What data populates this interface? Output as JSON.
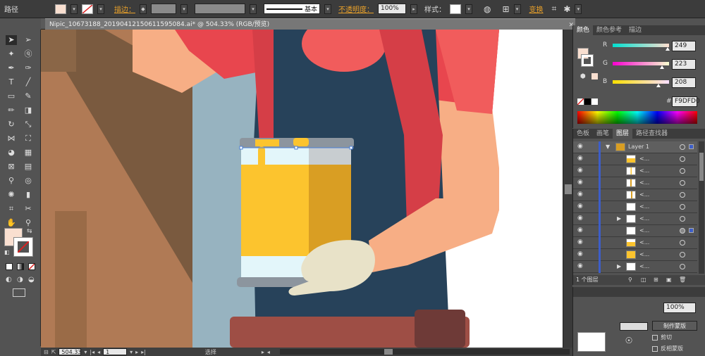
{
  "control_bar": {
    "path_label": "路径",
    "stroke_link": "描边：",
    "stroke_style": "基本",
    "opacity_link": "不透明度：",
    "opacity_value": "100%",
    "style_label": "样式：",
    "transform_link": "变换"
  },
  "document": {
    "tab_title": "Nipic_10673188_20190412150611595084.ai* @ 504.33% (RGB/预览)",
    "close_glyph": "✕"
  },
  "status_bar": {
    "zoom": "504.33",
    "artboard": "1",
    "tool_name": "选择"
  },
  "color_panel": {
    "tabs": [
      "颜色",
      "颜色参考",
      "描边"
    ],
    "channels": [
      {
        "label": "R",
        "value": "249",
        "fraction": 0.976
      },
      {
        "label": "G",
        "value": "223",
        "fraction": 0.875
      },
      {
        "label": "B",
        "value": "208",
        "fraction": 0.816
      }
    ],
    "hex_symbol": "#",
    "hex": "F9DFD0",
    "fill_color": "#F9DFD0"
  },
  "layers_panel": {
    "tabs": [
      "色板",
      "画笔",
      "图层",
      "路径查找器"
    ],
    "layer_name": "Layer 1",
    "sublayer_label": "<...",
    "count_label": "1 个图层"
  },
  "bottom_panel": {
    "opacity_value": "100%",
    "make_mask_button": "制作蒙版",
    "clip_label": "剪切",
    "invert_mask_label": "反相蒙版"
  },
  "illustration_colors": {
    "shirt": "#E8464E",
    "apron": "#27425A",
    "skin": "#F7AE85",
    "glove": "#E8E2C8",
    "jar_lid": "#8C959E",
    "jar_liquid": "#FCC42E",
    "jar_shade": "#D99E23",
    "jar_glass": "#E3F6FA",
    "belt": "#9E4E45",
    "wall_brown": "#B07A55",
    "wall_shadow": "#7A5A3F",
    "bg_blue": "#97B3C0"
  }
}
